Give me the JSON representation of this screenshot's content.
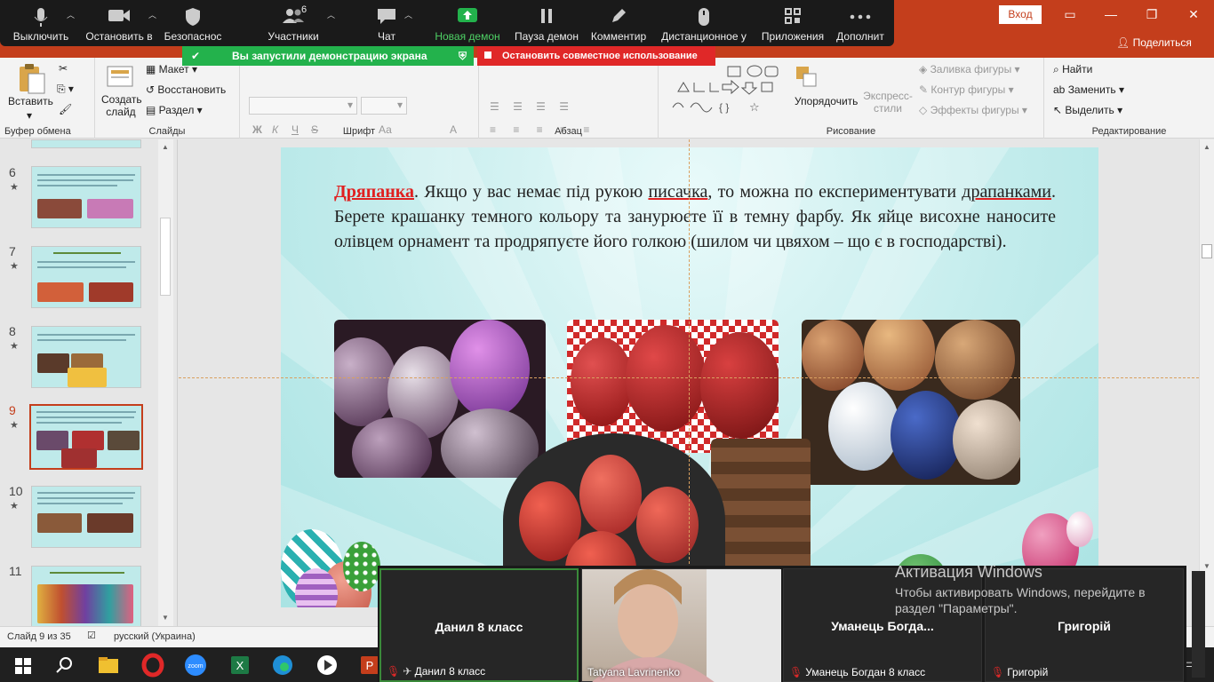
{
  "zoom_toolbar": {
    "items": [
      {
        "label": "Выключить",
        "icon": "microphone-icon"
      },
      {
        "label": "Остановить в",
        "icon": "video-camera-icon"
      },
      {
        "label": "Безопаснос",
        "icon": "shield-icon"
      },
      {
        "label": "Участники",
        "icon": "participants-icon",
        "count": "6"
      },
      {
        "label": "Чат",
        "icon": "chat-icon"
      },
      {
        "label": "Новая демон",
        "icon": "share-screen-icon"
      },
      {
        "label": "Пауза демон",
        "icon": "pause-icon"
      },
      {
        "label": "Комментир",
        "icon": "annotate-pen-icon"
      },
      {
        "label": "Дистанционное у",
        "icon": "remote-control-mouse-icon"
      },
      {
        "label": "Приложения",
        "icon": "apps-icon"
      },
      {
        "label": "Дополнит",
        "icon": "more-icon"
      }
    ],
    "sharing_banner": "Вы запустили демонстрацию экрана",
    "stop_sharing": "Остановить совместное использование"
  },
  "titlebar": {
    "signin": "Вход",
    "share": "Поделиться"
  },
  "ribbon": {
    "clipboard": {
      "paste": "Вставить",
      "label": "Буфер обмена"
    },
    "slides": {
      "new_slide": "Создать слайд",
      "layout": "Макет",
      "reset": "Восстановить",
      "section": "Раздел",
      "label": "Слайды"
    },
    "font": {
      "label": "Шрифт",
      "bold": "Ж",
      "italic": "К",
      "underline": "Ч",
      "strike": "S",
      "aa": "Аа",
      "font_color": "А"
    },
    "paragraph": {
      "label": "Абзац"
    },
    "drawing": {
      "arrange": "Упорядочить",
      "quick_styles": "Экспресс-стили",
      "fill": "Заливка фигуры",
      "outline": "Контур фигуры",
      "effects": "Эффекты фигуры",
      "label": "Рисование"
    },
    "editing": {
      "find": "Найти",
      "replace": "Заменить",
      "select": "Выделить",
      "label": "Редактирование"
    }
  },
  "thumbnails": [
    {
      "num": "6",
      "active": false
    },
    {
      "num": "7",
      "active": false
    },
    {
      "num": "8",
      "active": false
    },
    {
      "num": "9",
      "active": true
    },
    {
      "num": "10",
      "active": false
    },
    {
      "num": "11",
      "active": false
    }
  ],
  "slide": {
    "word": "Дряпанка",
    "text_1": ". Якщо у вас немає під рукою ",
    "underlined_1": "писачка",
    "text_2": ", то можна по експериментувати ",
    "underlined_2": "драпанками",
    "text_3": ". Берете крашанку темного кольору та занурюєте її в темну фарбу. Як яйце висохне наносите олівцем орнамент та продряпуєте його голкою (шилом чи цвяхом – що є в господарстві)."
  },
  "statusbar": {
    "slide_counter": "Слайд 9 из 35",
    "language": "русский (Украина)"
  },
  "gallery": {
    "tiles": [
      {
        "name": "Данил 8 класс",
        "label": "Данил 8 класс",
        "muted": true
      },
      {
        "name": "",
        "label": "Tatyana Lavrinenko",
        "muted": false
      },
      {
        "name": "Уманець  Богда...",
        "label": "Уманець Богдан 8 класс",
        "muted": true
      },
      {
        "name": "Григорій",
        "label": "Григорій",
        "muted": true
      }
    ]
  },
  "activation": {
    "title": "Активация Windows",
    "line1": "Чтобы активировать Windows, перейдите в",
    "line2": "раздел \"Параметры\"."
  },
  "colors": {
    "ppt_accent": "#c43e1c",
    "zoom_green": "#23b24c",
    "zoom_red": "#e02828"
  }
}
